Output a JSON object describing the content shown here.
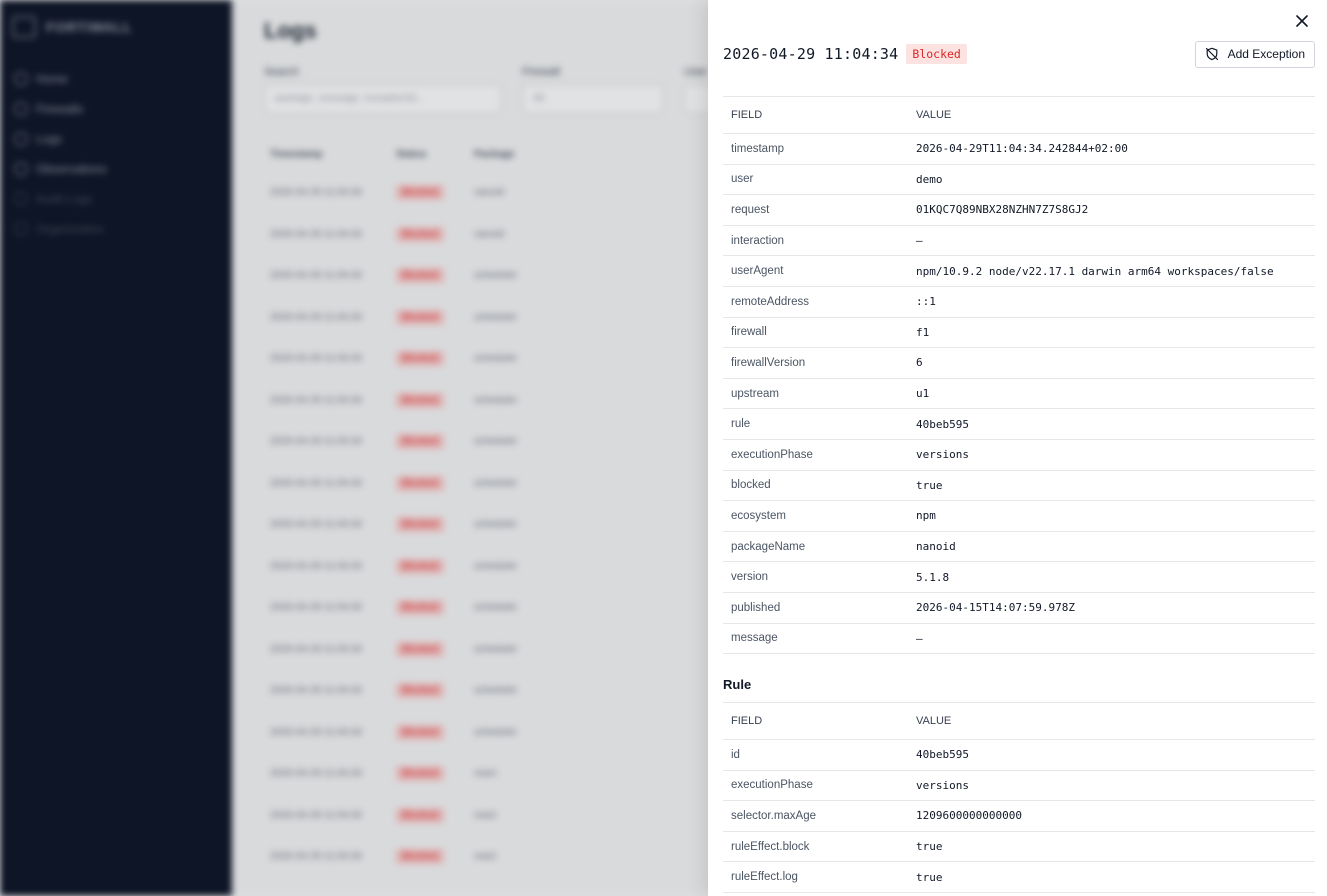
{
  "background": {
    "brand": "FORTIWALL",
    "nav": [
      "Home",
      "Firewalls",
      "Logs",
      "Observations",
      "Audit Logs",
      "Organization"
    ],
    "page_title": "Logs",
    "filters": [
      {
        "label": "Search",
        "placeholder": "package, message, exceptionId..."
      },
      {
        "label": "Firewall",
        "placeholder": "All"
      },
      {
        "label": "User",
        "placeholder": ""
      }
    ],
    "table_headers": [
      "Timestamp",
      "Status",
      "Package"
    ],
    "rows": [
      {
        "ts": "2026-04-29 11:04:34",
        "status": "Blocked",
        "pkg": "nanoid"
      },
      {
        "ts": "2026-04-29 11:04:34",
        "status": "Blocked",
        "pkg": "nanoid"
      },
      {
        "ts": "2026-04-29 11:04:34",
        "status": "Blocked",
        "pkg": "scheduler"
      },
      {
        "ts": "2026-04-29 11:04:34",
        "status": "Blocked",
        "pkg": "scheduler"
      },
      {
        "ts": "2026-04-29 11:04:34",
        "status": "Blocked",
        "pkg": "scheduler"
      },
      {
        "ts": "2026-04-29 11:04:34",
        "status": "Blocked",
        "pkg": "scheduler"
      },
      {
        "ts": "2026-04-29 11:04:34",
        "status": "Blocked",
        "pkg": "scheduler"
      },
      {
        "ts": "2026-04-29 11:04:34",
        "status": "Blocked",
        "pkg": "scheduler"
      },
      {
        "ts": "2026-04-29 11:04:34",
        "status": "Blocked",
        "pkg": "scheduler"
      },
      {
        "ts": "2026-04-29 11:04:34",
        "status": "Blocked",
        "pkg": "scheduler"
      },
      {
        "ts": "2026-04-29 11:04:34",
        "status": "Blocked",
        "pkg": "scheduler"
      },
      {
        "ts": "2026-04-29 11:04:34",
        "status": "Blocked",
        "pkg": "scheduler"
      },
      {
        "ts": "2026-04-29 11:04:34",
        "status": "Blocked",
        "pkg": "scheduler"
      },
      {
        "ts": "2026-04-29 11:04:34",
        "status": "Blocked",
        "pkg": "scheduler"
      },
      {
        "ts": "2026-04-29 11:04:34",
        "status": "Blocked",
        "pkg": "react"
      },
      {
        "ts": "2026-04-29 11:04:34",
        "status": "Blocked",
        "pkg": "react"
      },
      {
        "ts": "2026-04-29 11:04:34",
        "status": "Blocked",
        "pkg": "react"
      }
    ]
  },
  "drawer": {
    "title": "2026-04-29 11:04:34",
    "status": "Blocked",
    "add_exception_label": "Add Exception",
    "columns": {
      "field": "FIELD",
      "value": "VALUE"
    },
    "log_fields": [
      {
        "field": "timestamp",
        "value": "2026-04-29T11:04:34.242844+02:00"
      },
      {
        "field": "user",
        "value": "demo"
      },
      {
        "field": "request",
        "value": "01KQC7Q89NBX28NZHN7Z7S8GJ2"
      },
      {
        "field": "interaction",
        "value": "–"
      },
      {
        "field": "userAgent",
        "value": "npm/10.9.2 node/v22.17.1 darwin arm64 workspaces/false"
      },
      {
        "field": "remoteAddress",
        "value": "::1"
      },
      {
        "field": "firewall",
        "value": "f1"
      },
      {
        "field": "firewallVersion",
        "value": "6"
      },
      {
        "field": "upstream",
        "value": "u1"
      },
      {
        "field": "rule",
        "value": "40beb595"
      },
      {
        "field": "executionPhase",
        "value": "versions"
      },
      {
        "field": "blocked",
        "value": "true"
      },
      {
        "field": "ecosystem",
        "value": "npm"
      },
      {
        "field": "packageName",
        "value": "nanoid"
      },
      {
        "field": "version",
        "value": "5.1.8"
      },
      {
        "field": "published",
        "value": "2026-04-15T14:07:59.978Z"
      },
      {
        "field": "message",
        "value": "–"
      }
    ],
    "rule_section_title": "Rule",
    "rule_fields": [
      {
        "field": "id",
        "value": "40beb595"
      },
      {
        "field": "executionPhase",
        "value": "versions"
      },
      {
        "field": "selector.maxAge",
        "value": "1209600000000000"
      },
      {
        "field": "ruleEffect.block",
        "value": "true"
      },
      {
        "field": "ruleEffect.log",
        "value": "true"
      }
    ]
  },
  "icons": {
    "close": "close-icon",
    "add_exception": "shield-off-icon"
  },
  "colors": {
    "sidebar": "#0f1628",
    "blocked_bg": "#fde2e2",
    "blocked_text": "#dc2626"
  }
}
